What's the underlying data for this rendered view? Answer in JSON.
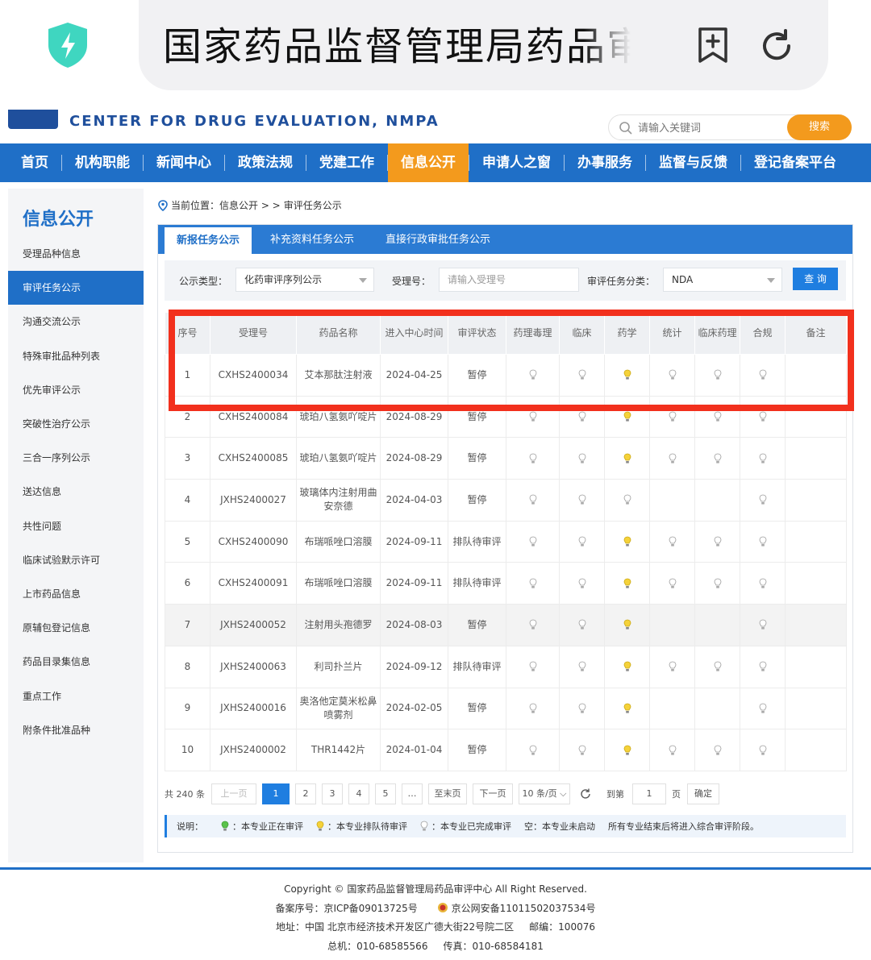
{
  "browser": {
    "url_title": "国家药品监督管理局药品审评中心",
    "colors": {
      "shield": "#3fd6c0"
    }
  },
  "site": {
    "name_en": "CENTER FOR DRUG EVALUATION, NMPA",
    "search_placeholder": "请输入关键词",
    "search_button": "搜索"
  },
  "nav": [
    "首页",
    "机构职能",
    "新闻中心",
    "政策法规",
    "党建工作",
    "信息公开",
    "申请人之窗",
    "办事服务",
    "监督与反馈",
    "登记备案平台"
  ],
  "nav_active_index": 5,
  "sidebar": {
    "title": "信息公开",
    "items": [
      "受理品种信息",
      "审评任务公示",
      "沟通交流公示",
      "特殊审批品种列表",
      "优先审评公示",
      "突破性治疗公示",
      "三合一序列公示",
      "送达信息",
      "共性问题",
      "临床试验默示许可",
      "上市药品信息",
      "原辅包登记信息",
      "药品目录集信息",
      "重点工作",
      "附条件批准品种"
    ],
    "active_index": 1
  },
  "breadcrumb": {
    "prefix": "当前位置：信息公开 > > ",
    "current": "审评任务公示"
  },
  "tabs": [
    "新报任务公示",
    "补充资料任务公示",
    "直接行政审批任务公示"
  ],
  "filters": {
    "type_label": "公示类型：",
    "type_value": "化药审评序列公示",
    "accept_label": "受理号：",
    "accept_placeholder": "请输入受理号",
    "category_label": "审评任务分类：",
    "category_value": "NDA",
    "query_button": "查 询"
  },
  "table": {
    "headers": [
      "序号",
      "受理号",
      "药品名称",
      "进入中心时间",
      "审评状态",
      "药理毒理",
      "临床",
      "药学",
      "统计",
      "临床药理",
      "合规",
      "备注"
    ],
    "rows": [
      {
        "no": "1",
        "id": "CXHS2400034",
        "name": "艾本那肽注射液",
        "date": "2024-04-25",
        "status": "暂停",
        "marks": [
          "g",
          "g",
          "y",
          "g",
          "g",
          "g"
        ]
      },
      {
        "no": "2",
        "id": "CXHS2400084",
        "name": "琥珀八氢氨吖啶片",
        "date": "2024-08-29",
        "status": "暂停",
        "marks": [
          "g",
          "g",
          "y",
          "g",
          "g",
          "g"
        ]
      },
      {
        "no": "3",
        "id": "CXHS2400085",
        "name": "琥珀八氢氨吖啶片",
        "date": "2024-08-29",
        "status": "暂停",
        "marks": [
          "g",
          "g",
          "y",
          "g",
          "g",
          "g"
        ]
      },
      {
        "no": "4",
        "id": "JXHS2400027",
        "name": "玻璃体内注射用曲安奈德",
        "date": "2024-04-03",
        "status": "暂停",
        "marks": [
          "g",
          "g",
          "g",
          "",
          "",
          "g"
        ]
      },
      {
        "no": "5",
        "id": "CXHS2400090",
        "name": "布瑞哌唑口溶膜",
        "date": "2024-09-11",
        "status": "排队待审评",
        "marks": [
          "g",
          "g",
          "y",
          "g",
          "g",
          "g"
        ]
      },
      {
        "no": "6",
        "id": "CXHS2400091",
        "name": "布瑞哌唑口溶膜",
        "date": "2024-09-11",
        "status": "排队待审评",
        "marks": [
          "g",
          "g",
          "y",
          "g",
          "g",
          "g"
        ]
      },
      {
        "no": "7",
        "id": "JXHS2400052",
        "name": "注射用头孢德罗",
        "date": "2024-08-03",
        "status": "暂停",
        "marks": [
          "g",
          "g",
          "y",
          "",
          "",
          "g"
        ]
      },
      {
        "no": "8",
        "id": "JXHS2400063",
        "name": "利司扑兰片",
        "date": "2024-09-12",
        "status": "排队待审评",
        "marks": [
          "g",
          "g",
          "y",
          "g",
          "g",
          "g"
        ]
      },
      {
        "no": "9",
        "id": "JXHS2400016",
        "name": "奥洛他定莫米松鼻喷雾剂",
        "date": "2024-02-05",
        "status": "暂停",
        "marks": [
          "g",
          "g",
          "y",
          "",
          "",
          "g"
        ]
      },
      {
        "no": "10",
        "id": "JXHS2400002",
        "name": "THR1442片",
        "date": "2024-01-04",
        "status": "暂停",
        "marks": [
          "g",
          "g",
          "y",
          "g",
          "g",
          "g"
        ]
      }
    ]
  },
  "pager": {
    "total": "共 240 条",
    "prev": "上一页",
    "pages": [
      "1",
      "2",
      "3",
      "4",
      "5",
      "…"
    ],
    "last": "至末页",
    "next": "下一页",
    "per_page": "10 条/页",
    "goto_label": "到第",
    "goto_value": "1",
    "page_unit": "页",
    "confirm": "确定"
  },
  "legend": {
    "prefix": "说明：",
    "reviewing": "：本专业正在审评",
    "queued": "：本专业排队待审评",
    "done": "：本专业已完成审评",
    "empty": "空：本专业未启动",
    "note": "所有专业结束后将进入综合审评阶段。"
  },
  "footer": {
    "copyright": "Copyright © 国家药品监督管理局药品审评中心   All Right Reserved.",
    "icp": "备案序号：京ICP备09013725号",
    "police": "京公网安备11011502037534号",
    "address": "地址：中国 北京市经济技术开发区广德大街22号院二区     邮编：100076",
    "phone": "总机：010-68585566     传真：010-68584181"
  }
}
